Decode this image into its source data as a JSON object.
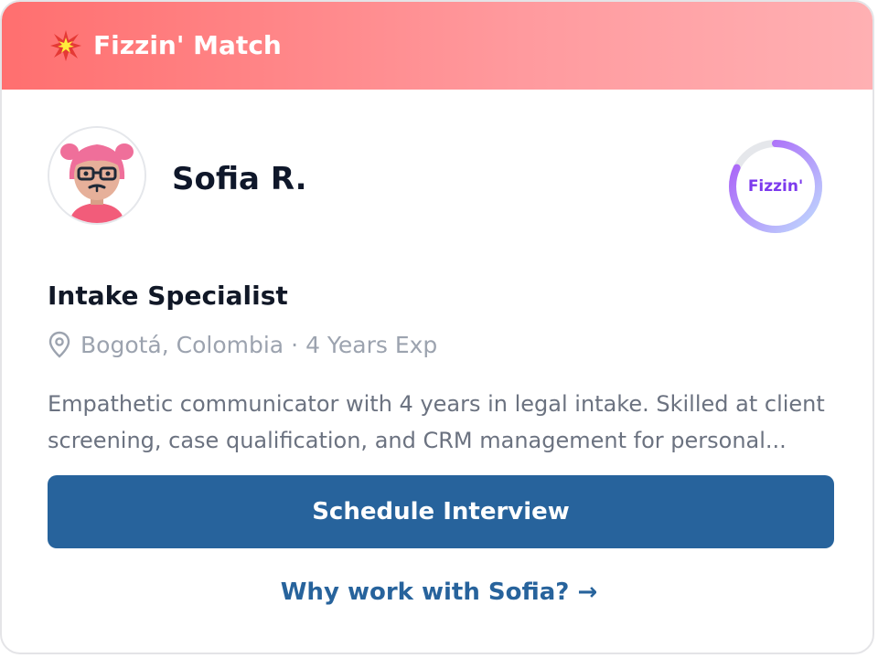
{
  "header": {
    "icon": "sparkle-burst-icon",
    "title": "Fizzin' Match",
    "colors": {
      "gradient_start": "#ff6f6f",
      "gradient_end": "#ffb0b3"
    }
  },
  "candidate": {
    "avatar": "avatar-illustration",
    "name": "Sofia R.",
    "job_title": "Intake Specialist",
    "location": "Bogotá, Colombia",
    "separator": "·",
    "experience": "4 Years Exp",
    "summary": "Empathetic communicator with 4 years in legal intake. Skilled at client screening, case qualification, and CRM management for personal..."
  },
  "score": {
    "label": "Fizzin'",
    "progress": 0.82,
    "colors": {
      "ring_start": "#a855f7",
      "ring_end": "#bfdbfe",
      "track": "#e5e7eb",
      "label": "#7c3aed"
    }
  },
  "actions": {
    "primary_label": "Schedule Interview",
    "secondary_label": "Why work with Sofia? →",
    "colors": {
      "primary_bg": "#27639c",
      "link": "#27639c"
    }
  }
}
